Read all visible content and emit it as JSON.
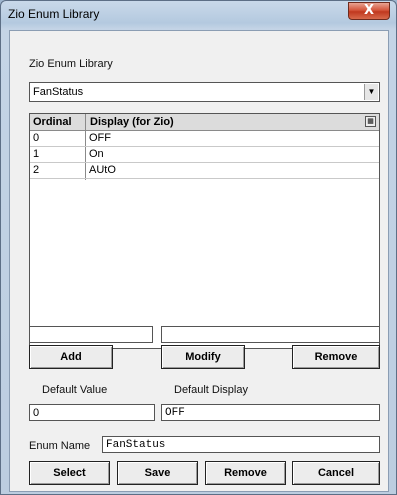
{
  "window": {
    "title": "Zio Enum Library",
    "close_glyph": "X"
  },
  "library": {
    "label": "Zio Enum Library",
    "selected": "FanStatus"
  },
  "table": {
    "columns": [
      "Ordinal",
      "Display (for Zio)"
    ],
    "rows": [
      [
        "0",
        "OFF"
      ],
      [
        "1",
        "On"
      ],
      [
        "2",
        "AUtO"
      ]
    ]
  },
  "edit": {
    "ordinal_value": "",
    "display_value": ""
  },
  "buttons": {
    "add": "Add",
    "modify": "Modify",
    "remove": "Remove",
    "select": "Select",
    "save": "Save",
    "remove2": "Remove",
    "cancel": "Cancel"
  },
  "defaults": {
    "value_label": "Default Value",
    "display_label": "Default Display",
    "value": "0",
    "display": "OFF"
  },
  "enum_name": {
    "label": "Enum Name",
    "value": "FanStatus"
  }
}
